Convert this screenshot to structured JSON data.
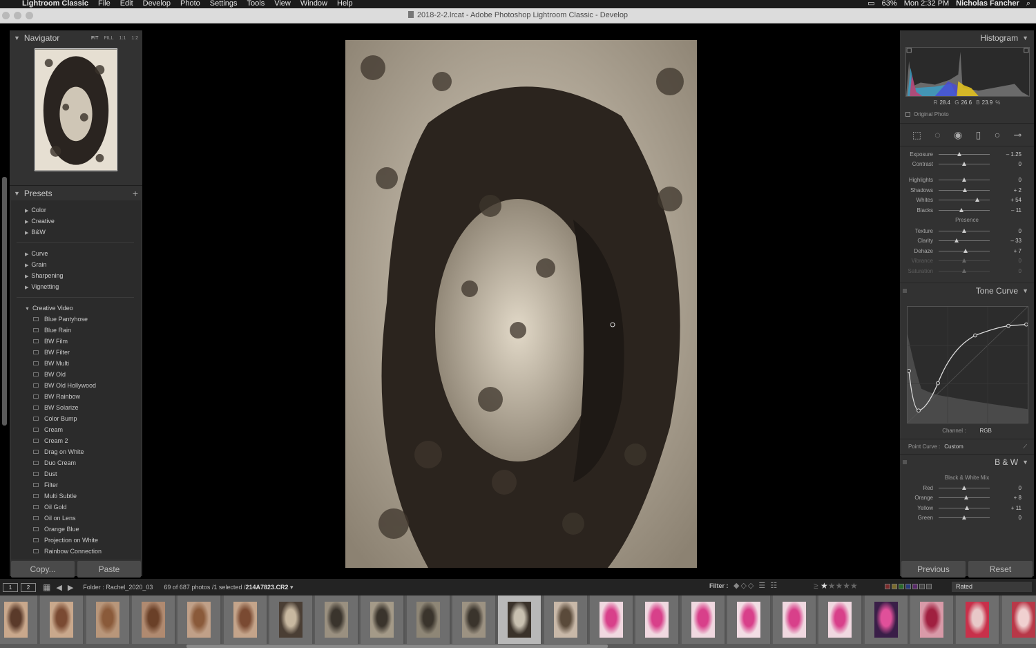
{
  "menubar": {
    "app": "Lightroom Classic",
    "menus": [
      "File",
      "Edit",
      "Develop",
      "Photo",
      "Settings",
      "Tools",
      "View",
      "Window",
      "Help"
    ],
    "battery": "63%",
    "clock": "Mon 2:32 PM",
    "user": "Nicholas Fancher"
  },
  "window": {
    "title": "2018-2-2.lrcat - Adobe Photoshop Lightroom Classic - Develop"
  },
  "navigator": {
    "title": "Navigator",
    "modes": [
      "FIT",
      "FILL",
      "1:1",
      "1:2"
    ]
  },
  "presets": {
    "title": "Presets",
    "groups_a": [
      "Color",
      "Creative",
      "B&W"
    ],
    "groups_b": [
      "Curve",
      "Grain",
      "Sharpening",
      "Vignetting"
    ],
    "open_group": "Creative Video",
    "items": [
      "Blue Pantyhose",
      "Blue Rain",
      "BW Film",
      "BW Filter",
      "BW Multi",
      "BW Old",
      "BW Old Hollywood",
      "BW Rainbow",
      "BW Solarize",
      "Color Bump",
      "Cream",
      "Cream 2",
      "Drag on White",
      "Duo Cream",
      "Dust",
      "Filter",
      "Multi Subtle",
      "Oil Gold",
      "Oil on Lens",
      "Orange Blue",
      "Projection on White",
      "Rainbow Connection"
    ]
  },
  "left_buttons": {
    "copy": "Copy...",
    "paste": "Paste"
  },
  "histogram": {
    "title": "Histogram",
    "r_label": "R",
    "r": "28.4",
    "g_label": "G",
    "g": "26.6",
    "b_label": "B",
    "b": "23.9",
    "unit": "%",
    "original_photo": "Original Photo"
  },
  "basic": {
    "sliders": [
      {
        "label": "Exposure",
        "value": "– 1.25",
        "pos": 0.4
      },
      {
        "label": "Contrast",
        "value": "0",
        "pos": 0.5
      },
      {
        "label": "Highlights",
        "value": "0",
        "pos": 0.5
      },
      {
        "label": "Shadows",
        "value": "+ 2",
        "pos": 0.51
      },
      {
        "label": "Whites",
        "value": "+ 54",
        "pos": 0.75
      },
      {
        "label": "Blacks",
        "value": "– 11",
        "pos": 0.45
      }
    ],
    "presence_label": "Presence",
    "presence": [
      {
        "label": "Texture",
        "value": "0",
        "pos": 0.5
      },
      {
        "label": "Clarity",
        "value": "– 33",
        "pos": 0.35
      },
      {
        "label": "Dehaze",
        "value": "+ 7",
        "pos": 0.53
      },
      {
        "label": "Vibrance",
        "value": "0",
        "pos": 0.5
      },
      {
        "label": "Saturation",
        "value": "0",
        "pos": 0.5
      }
    ]
  },
  "tone_curve": {
    "title": "Tone Curve",
    "channel_label": "Channel :",
    "channel": "RGB",
    "point_curve_label": "Point Curve :",
    "point_curve": "Custom"
  },
  "bw": {
    "title": "B & W",
    "mix_label": "Black & White Mix",
    "sliders": [
      {
        "label": "Red",
        "value": "0",
        "pos": 0.5
      },
      {
        "label": "Orange",
        "value": "+ 8",
        "pos": 0.54
      },
      {
        "label": "Yellow",
        "value": "+ 11",
        "pos": 0.55
      },
      {
        "label": "Green",
        "value": "0",
        "pos": 0.5
      }
    ]
  },
  "right_buttons": {
    "previous": "Previous",
    "reset": "Reset"
  },
  "filmbar": {
    "screen1": "1",
    "screen2": "2",
    "folder": "Folder : Rachel_2020_03",
    "count": "69 of 687 photos /1 selected /",
    "file": "214A7823.CR2",
    "filter_label": "Filter :",
    "rating_op": "≥",
    "rated": "Rated"
  }
}
